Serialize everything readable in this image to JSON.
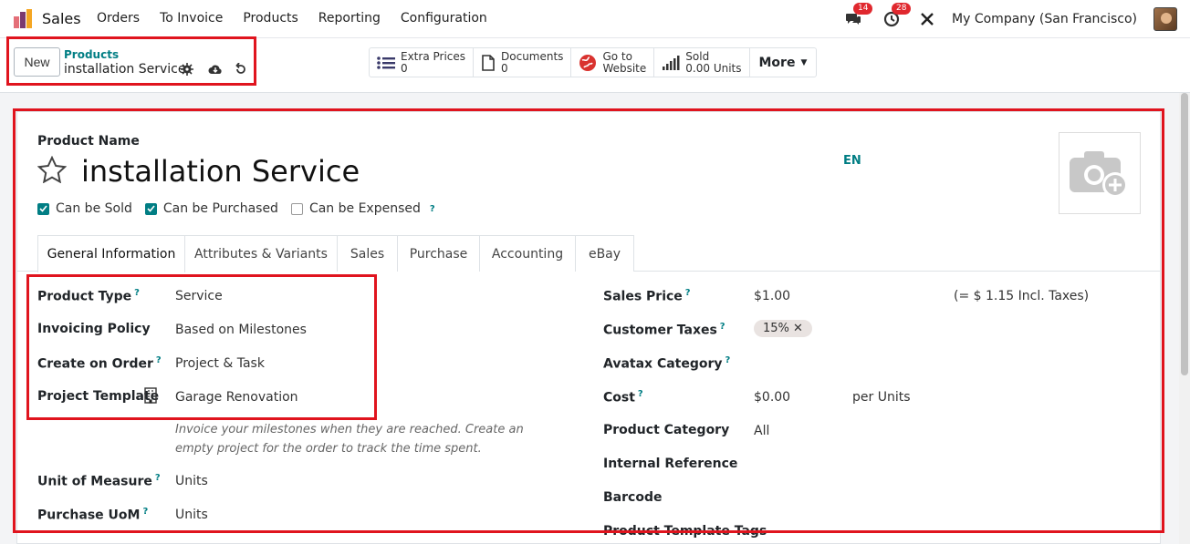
{
  "nav": {
    "app_name": "Sales",
    "menu": [
      "Orders",
      "To Invoice",
      "Products",
      "Reporting",
      "Configuration"
    ],
    "chat_count": "14",
    "activity_count": "28",
    "company": "My Company (San Francisco)"
  },
  "control": {
    "new_label": "New",
    "breadcrumb_parent": "Products",
    "breadcrumb_current": "installation Service",
    "smart_buttons": [
      {
        "label": "Extra Prices",
        "value": "0",
        "icon": "list-icon"
      },
      {
        "label": "Documents",
        "value": "0",
        "icon": "document-icon"
      },
      {
        "label": "Go to",
        "value": "Website",
        "icon": "globe-icon"
      },
      {
        "label": "Sold",
        "value": "0.00 Units",
        "icon": "bar-chart-icon"
      }
    ],
    "more_label": "More"
  },
  "form": {
    "name_label": "Product Name",
    "name": "installation Service",
    "lang": "EN",
    "checks": [
      {
        "label": "Can be Sold",
        "checked": true
      },
      {
        "label": "Can be Purchased",
        "checked": true
      },
      {
        "label": "Can be Expensed",
        "checked": false
      }
    ],
    "tabs": [
      "General Information",
      "Attributes & Variants",
      "Sales",
      "Purchase",
      "Accounting",
      "eBay"
    ],
    "left_fields": [
      {
        "label": "Product Type",
        "value": "Service"
      },
      {
        "label": "Invoicing Policy",
        "value": "Based on Milestones"
      },
      {
        "label": "Create on Order",
        "value": "Project & Task"
      },
      {
        "label": "Project Template",
        "value": "Garage Renovation"
      },
      {
        "label": "Unit of Measure",
        "value": "Units"
      },
      {
        "label": "Purchase UoM",
        "value": "Units"
      }
    ],
    "help_text": "Invoice your milestones when they are reached. Create an empty project for the order to track the time spent.",
    "right_fields": [
      {
        "label": "Sales Price",
        "value": "$1.00"
      },
      {
        "label": "Customer Taxes",
        "value": ""
      },
      {
        "label": "Avatax Category",
        "value": ""
      },
      {
        "label": "Cost",
        "value": "$0.00"
      },
      {
        "label": "Product Category",
        "value": "All"
      },
      {
        "label": "Internal Reference",
        "value": ""
      },
      {
        "label": "Barcode",
        "value": ""
      },
      {
        "label": "Product Template Tags",
        "value": ""
      }
    ],
    "incl_taxes": "(= $ 1.15 Incl. Taxes)",
    "tax_tag": "15%",
    "cost_unit": "per Units"
  },
  "colors": {
    "accent": "#017e84",
    "highlight": "#e0141e",
    "badge": "#e0282e"
  }
}
